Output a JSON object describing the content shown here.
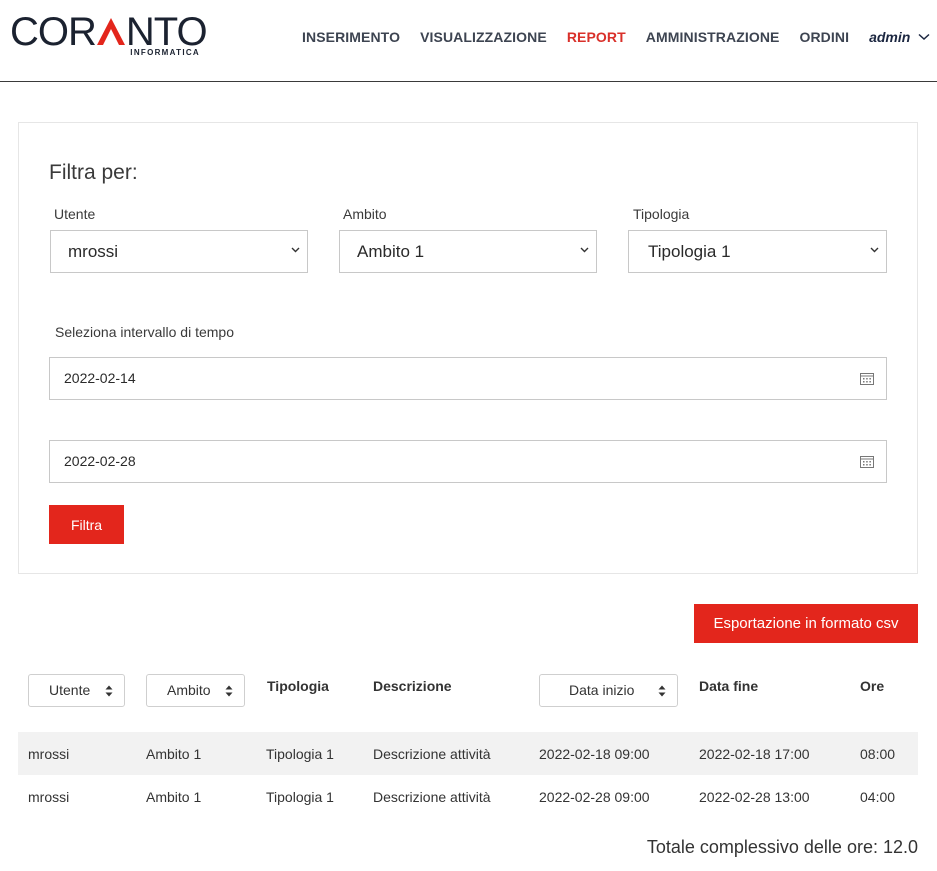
{
  "brand": {
    "logo_pre": "COR",
    "logo_post": "NTO",
    "logo_sub": "INFORMATICA",
    "accent_color": "#e3261c",
    "dark_color": "#1b2230"
  },
  "nav": {
    "items": [
      {
        "label": "INSERIMENTO"
      },
      {
        "label": "VISUALIZZAZIONE"
      },
      {
        "label": "REPORT"
      },
      {
        "label": "AMMINISTRAZIONE"
      },
      {
        "label": "ORDINI"
      }
    ],
    "active": "REPORT",
    "user": "admin",
    "user_icon": "chevron-down-icon"
  },
  "filter": {
    "title": "Filtra per:",
    "utente_label": "Utente",
    "utente_value": "mrossi",
    "ambito_label": "Ambito",
    "ambito_value": "Ambito 1",
    "tipologia_label": "Tipologia",
    "tipologia_value": "Tipologia 1",
    "interval_label": "Seleziona intervallo di tempo",
    "date_start": "2022-02-14",
    "date_end": "2022-02-28",
    "date_icon": "calendar-icon",
    "submit_label": "Filtra"
  },
  "export": {
    "label": "Esportazione in formato csv"
  },
  "table": {
    "headers": {
      "utente": "Utente",
      "ambito": "Ambito",
      "tipologia": "Tipologia",
      "descrizione": "Descrizione",
      "data_inizio": "Data inizio",
      "data_fine": "Data fine",
      "ore": "Ore"
    },
    "sort_icon": "sort-updown-icon",
    "rows": [
      {
        "utente": "mrossi",
        "ambito": "Ambito 1",
        "tipologia": "Tipologia 1",
        "descrizione": "Descrizione attività",
        "data_inizio": "2022-02-18 09:00",
        "data_fine": "2022-02-18 17:00",
        "ore": "08:00"
      },
      {
        "utente": "mrossi",
        "ambito": "Ambito 1",
        "tipologia": "Tipologia 1",
        "descrizione": "Descrizione attività",
        "data_inizio": "2022-02-28 09:00",
        "data_fine": "2022-02-28 13:00",
        "ore": "04:00"
      }
    ]
  },
  "total": {
    "label": "Totale complessivo delle ore: 12.0"
  }
}
